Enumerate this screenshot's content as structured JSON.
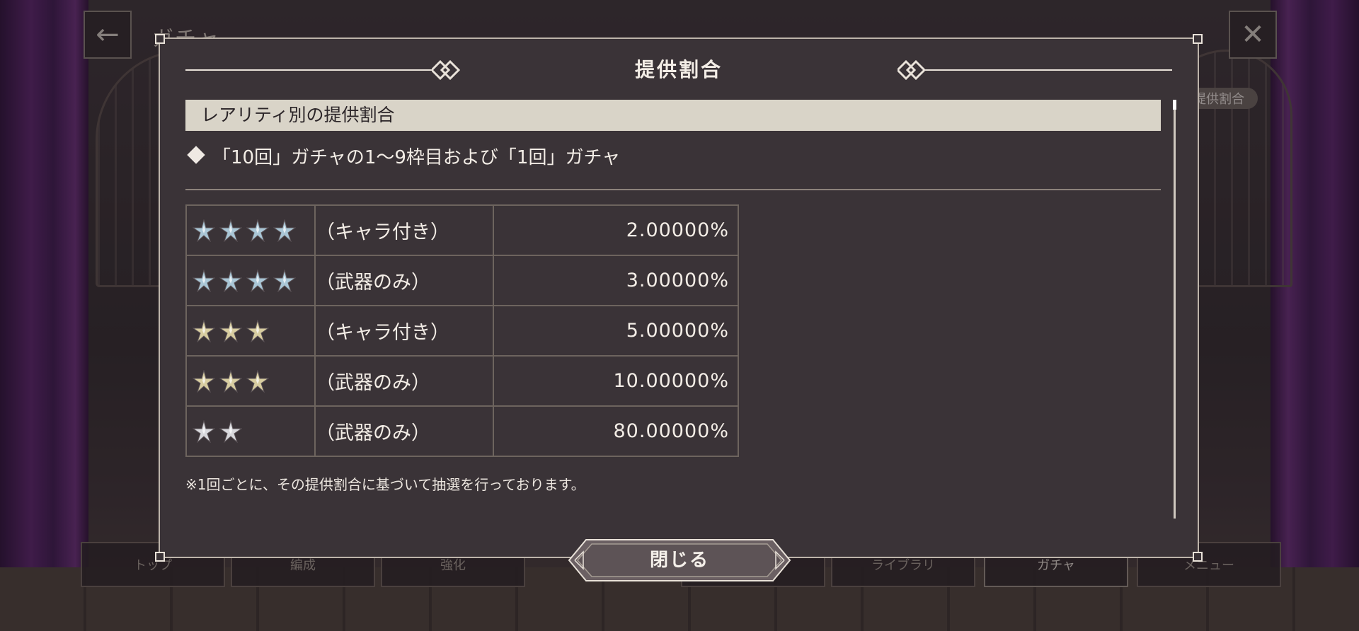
{
  "background": {
    "screen_title": "ガチャ",
    "rate_badge": "提供割合",
    "bottom_tabs": [
      "トップ",
      "編成",
      "強化",
      "",
      "",
      "ライブラリ",
      "ガチャ",
      "メニュー"
    ]
  },
  "modal": {
    "title": "提供割合",
    "section_header": "レアリティ別の提供割合",
    "sub_heading": "「10回」ガチャの1～9枠目および「1回」ガチャ",
    "rows": [
      {
        "stars": 4,
        "star_color": "blue",
        "type": "（キャラ付き）",
        "rate": "2.00000%"
      },
      {
        "stars": 4,
        "star_color": "blue",
        "type": "（武器のみ）",
        "rate": "3.00000%"
      },
      {
        "stars": 3,
        "star_color": "gold",
        "type": "（キャラ付き）",
        "rate": "5.00000%"
      },
      {
        "stars": 3,
        "star_color": "gold",
        "type": "（武器のみ）",
        "rate": "10.00000%"
      },
      {
        "stars": 2,
        "star_color": "silver",
        "type": "（武器のみ）",
        "rate": "80.00000%"
      }
    ],
    "note": "※1回ごとに、その提供割合に基づいて抽選を行っております。",
    "close_label": "閉じる",
    "colors": {
      "panel": "#3a3337",
      "header": "#d9d4c8",
      "star_blue": "#a9c6d6",
      "star_gold": "#d8cda0",
      "star_silver": "#d8d8dc"
    }
  }
}
